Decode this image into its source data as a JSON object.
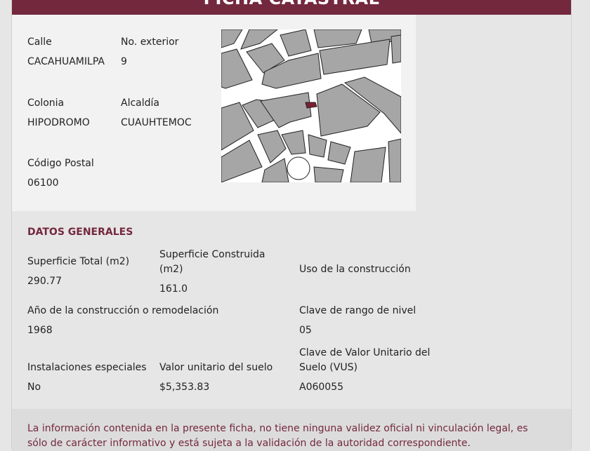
{
  "header": {
    "title": "FICHA CATASTRAL"
  },
  "location": {
    "calle_label": "Calle",
    "calle_value": "CACAHUAMILPA",
    "numero_label": "No. exterior",
    "numero_value": "9",
    "colonia_label": "Colonia",
    "colonia_value": "HIPODROMO",
    "alcaldia_label": "Alcaldía",
    "alcaldia_value": "CUAUHTEMOC",
    "cp_label": "Código Postal",
    "cp_value": "06100"
  },
  "colors": {
    "brand": "#74283e",
    "parcel": "#7a1f33",
    "block": "#a6a6a6",
    "street": "#ffffff"
  },
  "datos": {
    "title": "DATOS GENERALES",
    "sup_total_label": "Superficie Total (m2)",
    "sup_total_value": "290.77",
    "sup_const_label_1": "Superficie Construida",
    "sup_const_label_2": "(m2)",
    "sup_const_value": "161.0",
    "uso_label": "Uso de la construcción",
    "anio_label": "Año de la construcción o remodelación",
    "anio_value": "1968",
    "rango_label": "Clave de rango de nivel",
    "rango_value": "05",
    "inst_label": "Instalaciones especiales",
    "inst_value": "No",
    "valor_label": "Valor unitario del suelo",
    "valor_value": "$5,353.83",
    "vus_label_1": "Clave de Valor Unitario del",
    "vus_label_2": "Suelo (VUS)",
    "vus_value": "A060055"
  },
  "disclaimer": {
    "text": "La información contenida en la presente ficha, no tiene ninguna validez oficial ni vinculación legal, es sólo de carácter informativo y está sujeta a la validación de la autoridad correspondiente."
  }
}
